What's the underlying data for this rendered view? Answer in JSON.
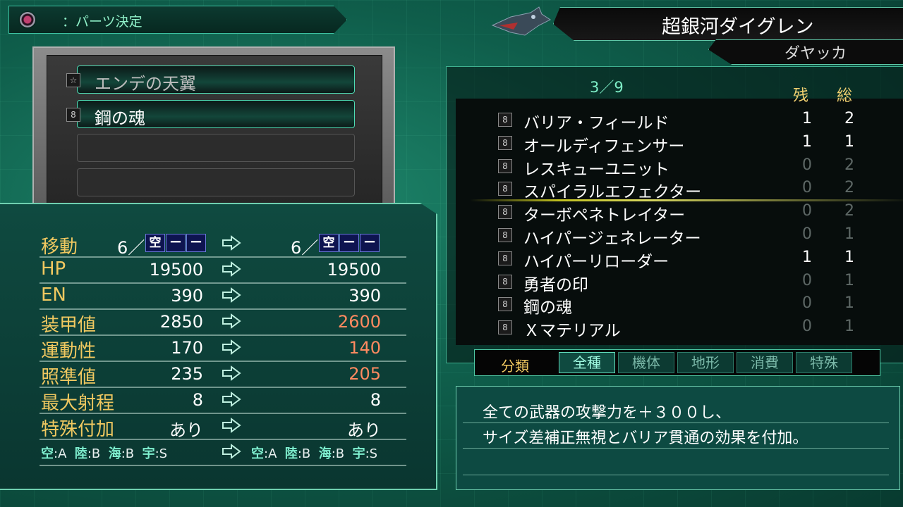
{
  "header": {
    "confirm_label": "：パーツ決定",
    "unit_name": "超銀河ダイグレン",
    "pilot_name": "ダヤッカ"
  },
  "equipped_slots": [
    {
      "label": "エンデの天翼",
      "icon": "star-icon"
    },
    {
      "label": "鋼の魂",
      "icon": "lock-icon"
    },
    {
      "label": ""
    },
    {
      "label": ""
    }
  ],
  "stats": {
    "move": {
      "label": "移動",
      "before": "6／",
      "after": "6／",
      "tags": [
        "空",
        "ー",
        "ー"
      ]
    },
    "rows": [
      {
        "label": "HP",
        "before": "19500",
        "after": "19500"
      },
      {
        "label": "EN",
        "before": "390",
        "after": "390"
      },
      {
        "label": "装甲値",
        "before": "2850",
        "after": "2600"
      },
      {
        "label": "運動性",
        "before": "170",
        "after": "140"
      },
      {
        "label": "照準値",
        "before": "235",
        "after": "205"
      },
      {
        "label": "最大射程",
        "before": "8",
        "after": "8"
      },
      {
        "label": "特殊付加",
        "before": "あり",
        "after": "あり"
      }
    ],
    "terrain_before": {
      "sky_k": "空",
      "sky_v": ":A",
      "land_k": "陸",
      "land_v": ":B",
      "sea_k": "海",
      "sea_v": ":B",
      "space_k": "宇",
      "space_v": ":S"
    },
    "terrain_after": {
      "sky_k": "空",
      "sky_v": ":A",
      "land_k": "陸",
      "land_v": ":B",
      "sea_k": "海",
      "sea_v": ":B",
      "space_k": "宇",
      "space_v": ":S"
    }
  },
  "parts_list": {
    "page": "3／9",
    "col_remaining": "残",
    "col_total": "総",
    "items": [
      {
        "name": "バリア・フィールド",
        "remaining": "1",
        "total": "2"
      },
      {
        "name": "オールディフェンサー",
        "remaining": "1",
        "total": "1"
      },
      {
        "name": "レスキューユニット",
        "remaining": "0",
        "total": "2"
      },
      {
        "name": "スパイラルエフェクター",
        "remaining": "0",
        "total": "2"
      },
      {
        "name": "ターボペネトレイター",
        "remaining": "0",
        "total": "2"
      },
      {
        "name": "ハイパージェネレーター",
        "remaining": "0",
        "total": "1"
      },
      {
        "name": "ハイパーリローダー",
        "remaining": "1",
        "total": "1"
      },
      {
        "name": "勇者の印",
        "remaining": "0",
        "total": "1"
      },
      {
        "name": "鋼の魂",
        "remaining": "0",
        "total": "1"
      },
      {
        "name": "Ｘマテリアル",
        "remaining": "0",
        "total": "1"
      }
    ]
  },
  "filter": {
    "label": "分類",
    "tabs": [
      "全種",
      "機体",
      "地形",
      "消費",
      "特殊"
    ],
    "active": "全種"
  },
  "description": {
    "line1": "全ての武器の攻撃力を＋３００し、",
    "line2": "サイズ差補正無視とバリア貫通の効果を付加。",
    "line3": ""
  },
  "colors": {
    "accent": "#4fdcb4",
    "label_gold": "#f0c860",
    "decrease": "#ff8a60"
  }
}
